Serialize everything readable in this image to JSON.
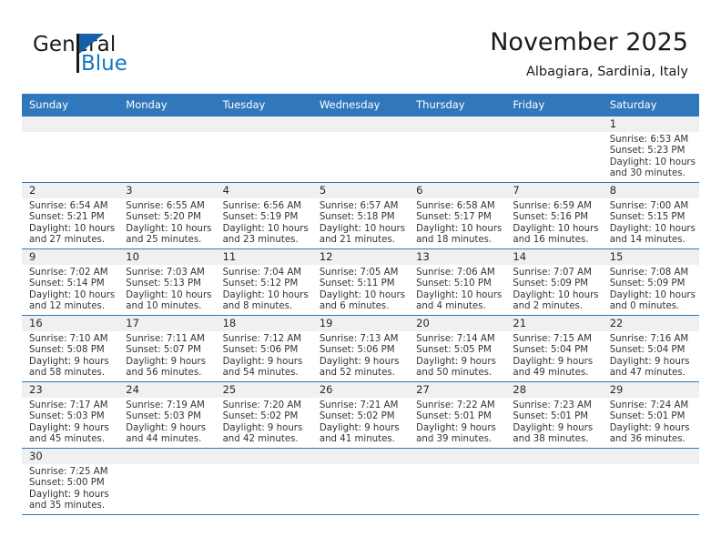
{
  "brand": {
    "name_part1": "General",
    "name_part2": "Blue",
    "accent_color": "#1277c4",
    "flag_color": "#1560a8"
  },
  "header": {
    "title": "November 2025",
    "subtitle": "Albagiara, Sardinia, Italy"
  },
  "calendar": {
    "header_bg": "#3077bc",
    "daynum_bg": "#f0f0f0",
    "weekdays": [
      "Sunday",
      "Monday",
      "Tuesday",
      "Wednesday",
      "Thursday",
      "Friday",
      "Saturday"
    ],
    "weeks": [
      [
        {
          "day": "",
          "sunrise": "",
          "sunset": "",
          "daylight1": "",
          "daylight2": ""
        },
        {
          "day": "",
          "sunrise": "",
          "sunset": "",
          "daylight1": "",
          "daylight2": ""
        },
        {
          "day": "",
          "sunrise": "",
          "sunset": "",
          "daylight1": "",
          "daylight2": ""
        },
        {
          "day": "",
          "sunrise": "",
          "sunset": "",
          "daylight1": "",
          "daylight2": ""
        },
        {
          "day": "",
          "sunrise": "",
          "sunset": "",
          "daylight1": "",
          "daylight2": ""
        },
        {
          "day": "",
          "sunrise": "",
          "sunset": "",
          "daylight1": "",
          "daylight2": ""
        },
        {
          "day": "1",
          "sunrise": "Sunrise: 6:53 AM",
          "sunset": "Sunset: 5:23 PM",
          "daylight1": "Daylight: 10 hours",
          "daylight2": "and 30 minutes."
        }
      ],
      [
        {
          "day": "2",
          "sunrise": "Sunrise: 6:54 AM",
          "sunset": "Sunset: 5:21 PM",
          "daylight1": "Daylight: 10 hours",
          "daylight2": "and 27 minutes."
        },
        {
          "day": "3",
          "sunrise": "Sunrise: 6:55 AM",
          "sunset": "Sunset: 5:20 PM",
          "daylight1": "Daylight: 10 hours",
          "daylight2": "and 25 minutes."
        },
        {
          "day": "4",
          "sunrise": "Sunrise: 6:56 AM",
          "sunset": "Sunset: 5:19 PM",
          "daylight1": "Daylight: 10 hours",
          "daylight2": "and 23 minutes."
        },
        {
          "day": "5",
          "sunrise": "Sunrise: 6:57 AM",
          "sunset": "Sunset: 5:18 PM",
          "daylight1": "Daylight: 10 hours",
          "daylight2": "and 21 minutes."
        },
        {
          "day": "6",
          "sunrise": "Sunrise: 6:58 AM",
          "sunset": "Sunset: 5:17 PM",
          "daylight1": "Daylight: 10 hours",
          "daylight2": "and 18 minutes."
        },
        {
          "day": "7",
          "sunrise": "Sunrise: 6:59 AM",
          "sunset": "Sunset: 5:16 PM",
          "daylight1": "Daylight: 10 hours",
          "daylight2": "and 16 minutes."
        },
        {
          "day": "8",
          "sunrise": "Sunrise: 7:00 AM",
          "sunset": "Sunset: 5:15 PM",
          "daylight1": "Daylight: 10 hours",
          "daylight2": "and 14 minutes."
        }
      ],
      [
        {
          "day": "9",
          "sunrise": "Sunrise: 7:02 AM",
          "sunset": "Sunset: 5:14 PM",
          "daylight1": "Daylight: 10 hours",
          "daylight2": "and 12 minutes."
        },
        {
          "day": "10",
          "sunrise": "Sunrise: 7:03 AM",
          "sunset": "Sunset: 5:13 PM",
          "daylight1": "Daylight: 10 hours",
          "daylight2": "and 10 minutes."
        },
        {
          "day": "11",
          "sunrise": "Sunrise: 7:04 AM",
          "sunset": "Sunset: 5:12 PM",
          "daylight1": "Daylight: 10 hours",
          "daylight2": "and 8 minutes."
        },
        {
          "day": "12",
          "sunrise": "Sunrise: 7:05 AM",
          "sunset": "Sunset: 5:11 PM",
          "daylight1": "Daylight: 10 hours",
          "daylight2": "and 6 minutes."
        },
        {
          "day": "13",
          "sunrise": "Sunrise: 7:06 AM",
          "sunset": "Sunset: 5:10 PM",
          "daylight1": "Daylight: 10 hours",
          "daylight2": "and 4 minutes."
        },
        {
          "day": "14",
          "sunrise": "Sunrise: 7:07 AM",
          "sunset": "Sunset: 5:09 PM",
          "daylight1": "Daylight: 10 hours",
          "daylight2": "and 2 minutes."
        },
        {
          "day": "15",
          "sunrise": "Sunrise: 7:08 AM",
          "sunset": "Sunset: 5:09 PM",
          "daylight1": "Daylight: 10 hours",
          "daylight2": "and 0 minutes."
        }
      ],
      [
        {
          "day": "16",
          "sunrise": "Sunrise: 7:10 AM",
          "sunset": "Sunset: 5:08 PM",
          "daylight1": "Daylight: 9 hours",
          "daylight2": "and 58 minutes."
        },
        {
          "day": "17",
          "sunrise": "Sunrise: 7:11 AM",
          "sunset": "Sunset: 5:07 PM",
          "daylight1": "Daylight: 9 hours",
          "daylight2": "and 56 minutes."
        },
        {
          "day": "18",
          "sunrise": "Sunrise: 7:12 AM",
          "sunset": "Sunset: 5:06 PM",
          "daylight1": "Daylight: 9 hours",
          "daylight2": "and 54 minutes."
        },
        {
          "day": "19",
          "sunrise": "Sunrise: 7:13 AM",
          "sunset": "Sunset: 5:06 PM",
          "daylight1": "Daylight: 9 hours",
          "daylight2": "and 52 minutes."
        },
        {
          "day": "20",
          "sunrise": "Sunrise: 7:14 AM",
          "sunset": "Sunset: 5:05 PM",
          "daylight1": "Daylight: 9 hours",
          "daylight2": "and 50 minutes."
        },
        {
          "day": "21",
          "sunrise": "Sunrise: 7:15 AM",
          "sunset": "Sunset: 5:04 PM",
          "daylight1": "Daylight: 9 hours",
          "daylight2": "and 49 minutes."
        },
        {
          "day": "22",
          "sunrise": "Sunrise: 7:16 AM",
          "sunset": "Sunset: 5:04 PM",
          "daylight1": "Daylight: 9 hours",
          "daylight2": "and 47 minutes."
        }
      ],
      [
        {
          "day": "23",
          "sunrise": "Sunrise: 7:17 AM",
          "sunset": "Sunset: 5:03 PM",
          "daylight1": "Daylight: 9 hours",
          "daylight2": "and 45 minutes."
        },
        {
          "day": "24",
          "sunrise": "Sunrise: 7:19 AM",
          "sunset": "Sunset: 5:03 PM",
          "daylight1": "Daylight: 9 hours",
          "daylight2": "and 44 minutes."
        },
        {
          "day": "25",
          "sunrise": "Sunrise: 7:20 AM",
          "sunset": "Sunset: 5:02 PM",
          "daylight1": "Daylight: 9 hours",
          "daylight2": "and 42 minutes."
        },
        {
          "day": "26",
          "sunrise": "Sunrise: 7:21 AM",
          "sunset": "Sunset: 5:02 PM",
          "daylight1": "Daylight: 9 hours",
          "daylight2": "and 41 minutes."
        },
        {
          "day": "27",
          "sunrise": "Sunrise: 7:22 AM",
          "sunset": "Sunset: 5:01 PM",
          "daylight1": "Daylight: 9 hours",
          "daylight2": "and 39 minutes."
        },
        {
          "day": "28",
          "sunrise": "Sunrise: 7:23 AM",
          "sunset": "Sunset: 5:01 PM",
          "daylight1": "Daylight: 9 hours",
          "daylight2": "and 38 minutes."
        },
        {
          "day": "29",
          "sunrise": "Sunrise: 7:24 AM",
          "sunset": "Sunset: 5:01 PM",
          "daylight1": "Daylight: 9 hours",
          "daylight2": "and 36 minutes."
        }
      ],
      [
        {
          "day": "30",
          "sunrise": "Sunrise: 7:25 AM",
          "sunset": "Sunset: 5:00 PM",
          "daylight1": "Daylight: 9 hours",
          "daylight2": "and 35 minutes."
        },
        {
          "day": "",
          "sunrise": "",
          "sunset": "",
          "daylight1": "",
          "daylight2": ""
        },
        {
          "day": "",
          "sunrise": "",
          "sunset": "",
          "daylight1": "",
          "daylight2": ""
        },
        {
          "day": "",
          "sunrise": "",
          "sunset": "",
          "daylight1": "",
          "daylight2": ""
        },
        {
          "day": "",
          "sunrise": "",
          "sunset": "",
          "daylight1": "",
          "daylight2": ""
        },
        {
          "day": "",
          "sunrise": "",
          "sunset": "",
          "daylight1": "",
          "daylight2": ""
        },
        {
          "day": "",
          "sunrise": "",
          "sunset": "",
          "daylight1": "",
          "daylight2": ""
        }
      ]
    ]
  }
}
